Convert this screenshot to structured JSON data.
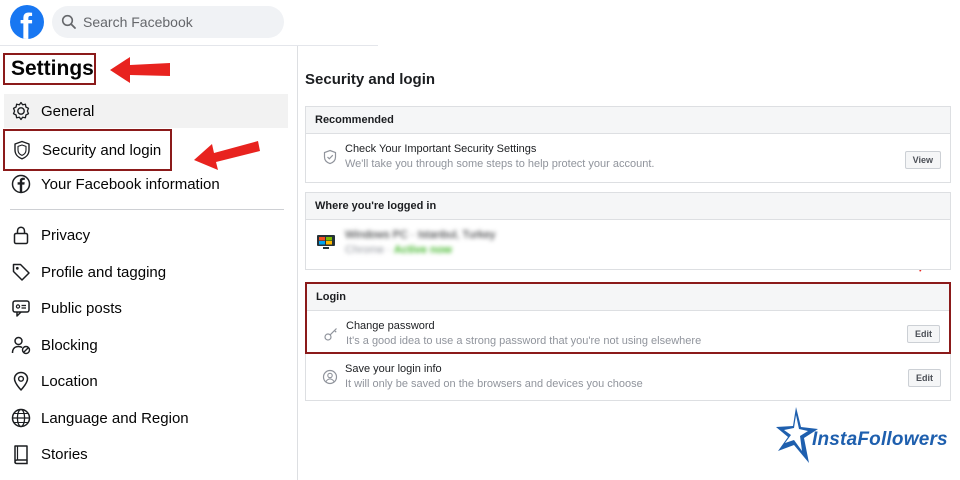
{
  "header": {
    "logo_letter": "f",
    "search_placeholder": "Search Facebook"
  },
  "sidebar": {
    "title": "Settings",
    "items": [
      {
        "label": "General",
        "icon": "gear-icon"
      },
      {
        "label": "Security and login",
        "icon": "shield-icon"
      },
      {
        "label": "Your Facebook information",
        "icon": "facebook-icon"
      },
      {
        "label": "Privacy",
        "icon": "lock-icon"
      },
      {
        "label": "Profile and tagging",
        "icon": "tag-icon"
      },
      {
        "label": "Public posts",
        "icon": "public-posts-icon"
      },
      {
        "label": "Blocking",
        "icon": "blocking-icon"
      },
      {
        "label": "Location",
        "icon": "location-pin-icon"
      },
      {
        "label": "Language and Region",
        "icon": "globe-icon"
      },
      {
        "label": "Stories",
        "icon": "book-icon"
      }
    ]
  },
  "main": {
    "title": "Security and login",
    "recommended": {
      "heading": "Recommended",
      "title": "Check Your Important Security Settings",
      "subtitle": "We'll take you through some steps to help protect your account.",
      "button": "View"
    },
    "logged_in": {
      "heading": "Where you're logged in",
      "device": "Windows PC · ",
      "device_location": "Istanbul, Turkey",
      "browser": "Chrome · ",
      "status": "Active now"
    },
    "login": {
      "heading": "Login",
      "change_password": {
        "title": "Change password",
        "subtitle": "It's a good idea to use a strong password that you're not using elsewhere",
        "button": "Edit"
      },
      "save_login": {
        "title": "Save your login info",
        "subtitle": "It will only be saved on the browsers and devices you choose",
        "button": "Edit"
      }
    }
  },
  "watermark": {
    "text": "InstaFollowers"
  },
  "colors": {
    "brand": "#1877f2",
    "highlight_box": "#8b1a1a",
    "arrow": "#e8231f",
    "active_status": "#42b72a",
    "watermark": "#1e5fae"
  }
}
